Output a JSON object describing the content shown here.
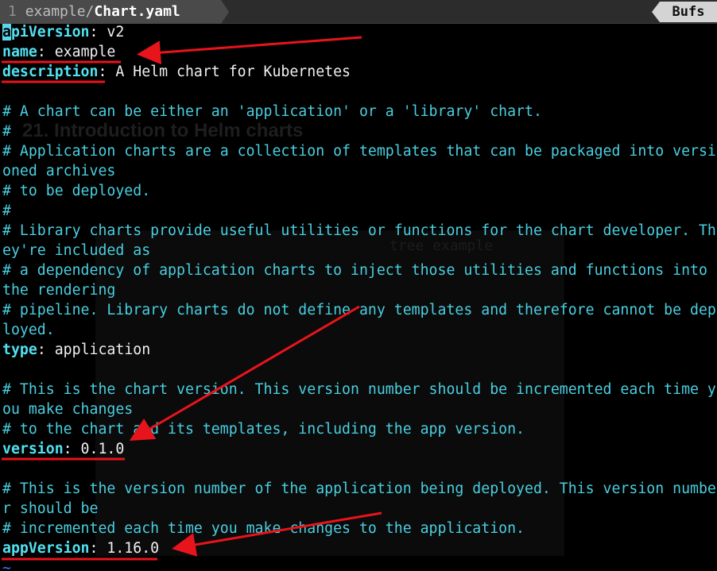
{
  "tabline": {
    "tab_number": "1",
    "tab_path": "example/",
    "tab_file": "Chart.yaml",
    "bufs_label": "Bufs"
  },
  "background_ghost": {
    "heading": "21. Introduction to Helm charts",
    "command": "tree example"
  },
  "editor": {
    "lines": [
      {
        "type": "kv",
        "key": "apiVersion",
        "sep": ":",
        "value": " v2",
        "cursor": true
      },
      {
        "type": "kv",
        "key": "name",
        "sep": ":",
        "value": " example"
      },
      {
        "type": "kv",
        "key": "description",
        "sep": ":",
        "value": " A Helm chart for Kubernetes"
      },
      {
        "type": "blank"
      },
      {
        "type": "comment",
        "text": "# A chart can be either an 'application' or a 'library' chart."
      },
      {
        "type": "comment",
        "text": "#"
      },
      {
        "type": "comment",
        "text": "# Application charts are a collection of templates that can be packaged into versi"
      },
      {
        "type": "comment",
        "text": "oned archives"
      },
      {
        "type": "comment",
        "text": "# to be deployed."
      },
      {
        "type": "comment",
        "text": "#"
      },
      {
        "type": "comment",
        "text": "# Library charts provide useful utilities or functions for the chart developer. Th"
      },
      {
        "type": "comment",
        "text": "ey're included as"
      },
      {
        "type": "comment",
        "text": "# a dependency of application charts to inject those utilities and functions into"
      },
      {
        "type": "comment",
        "text": "the rendering"
      },
      {
        "type": "comment",
        "text": "# pipeline. Library charts do not define any templates and therefore cannot be dep"
      },
      {
        "type": "comment",
        "text": "loyed."
      },
      {
        "type": "kv",
        "key": "type",
        "sep": ":",
        "value": " application"
      },
      {
        "type": "blank"
      },
      {
        "type": "comment",
        "text": "# This is the chart version. This version number should be incremented each time y"
      },
      {
        "type": "comment",
        "text": "ou make changes"
      },
      {
        "type": "comment",
        "text": "# to the chart and its templates, including the app version."
      },
      {
        "type": "kv",
        "key": "version",
        "sep": ":",
        "value": " 0.1.0"
      },
      {
        "type": "blank"
      },
      {
        "type": "comment",
        "text": "# This is the version number of the application being deployed. This version numbe"
      },
      {
        "type": "comment",
        "text": "r should be"
      },
      {
        "type": "comment",
        "text": "# incremented each time you make changes to the application."
      },
      {
        "type": "kv",
        "key": "appVersion",
        "sep": ":",
        "value": " 1.16.0"
      },
      {
        "type": "tilde",
        "text": "~"
      }
    ]
  },
  "colors": {
    "key": "#53e0f0",
    "comment": "#49cfe0",
    "value": "#f0f0f0",
    "annotation": "#e8141c",
    "background": "#000000"
  }
}
